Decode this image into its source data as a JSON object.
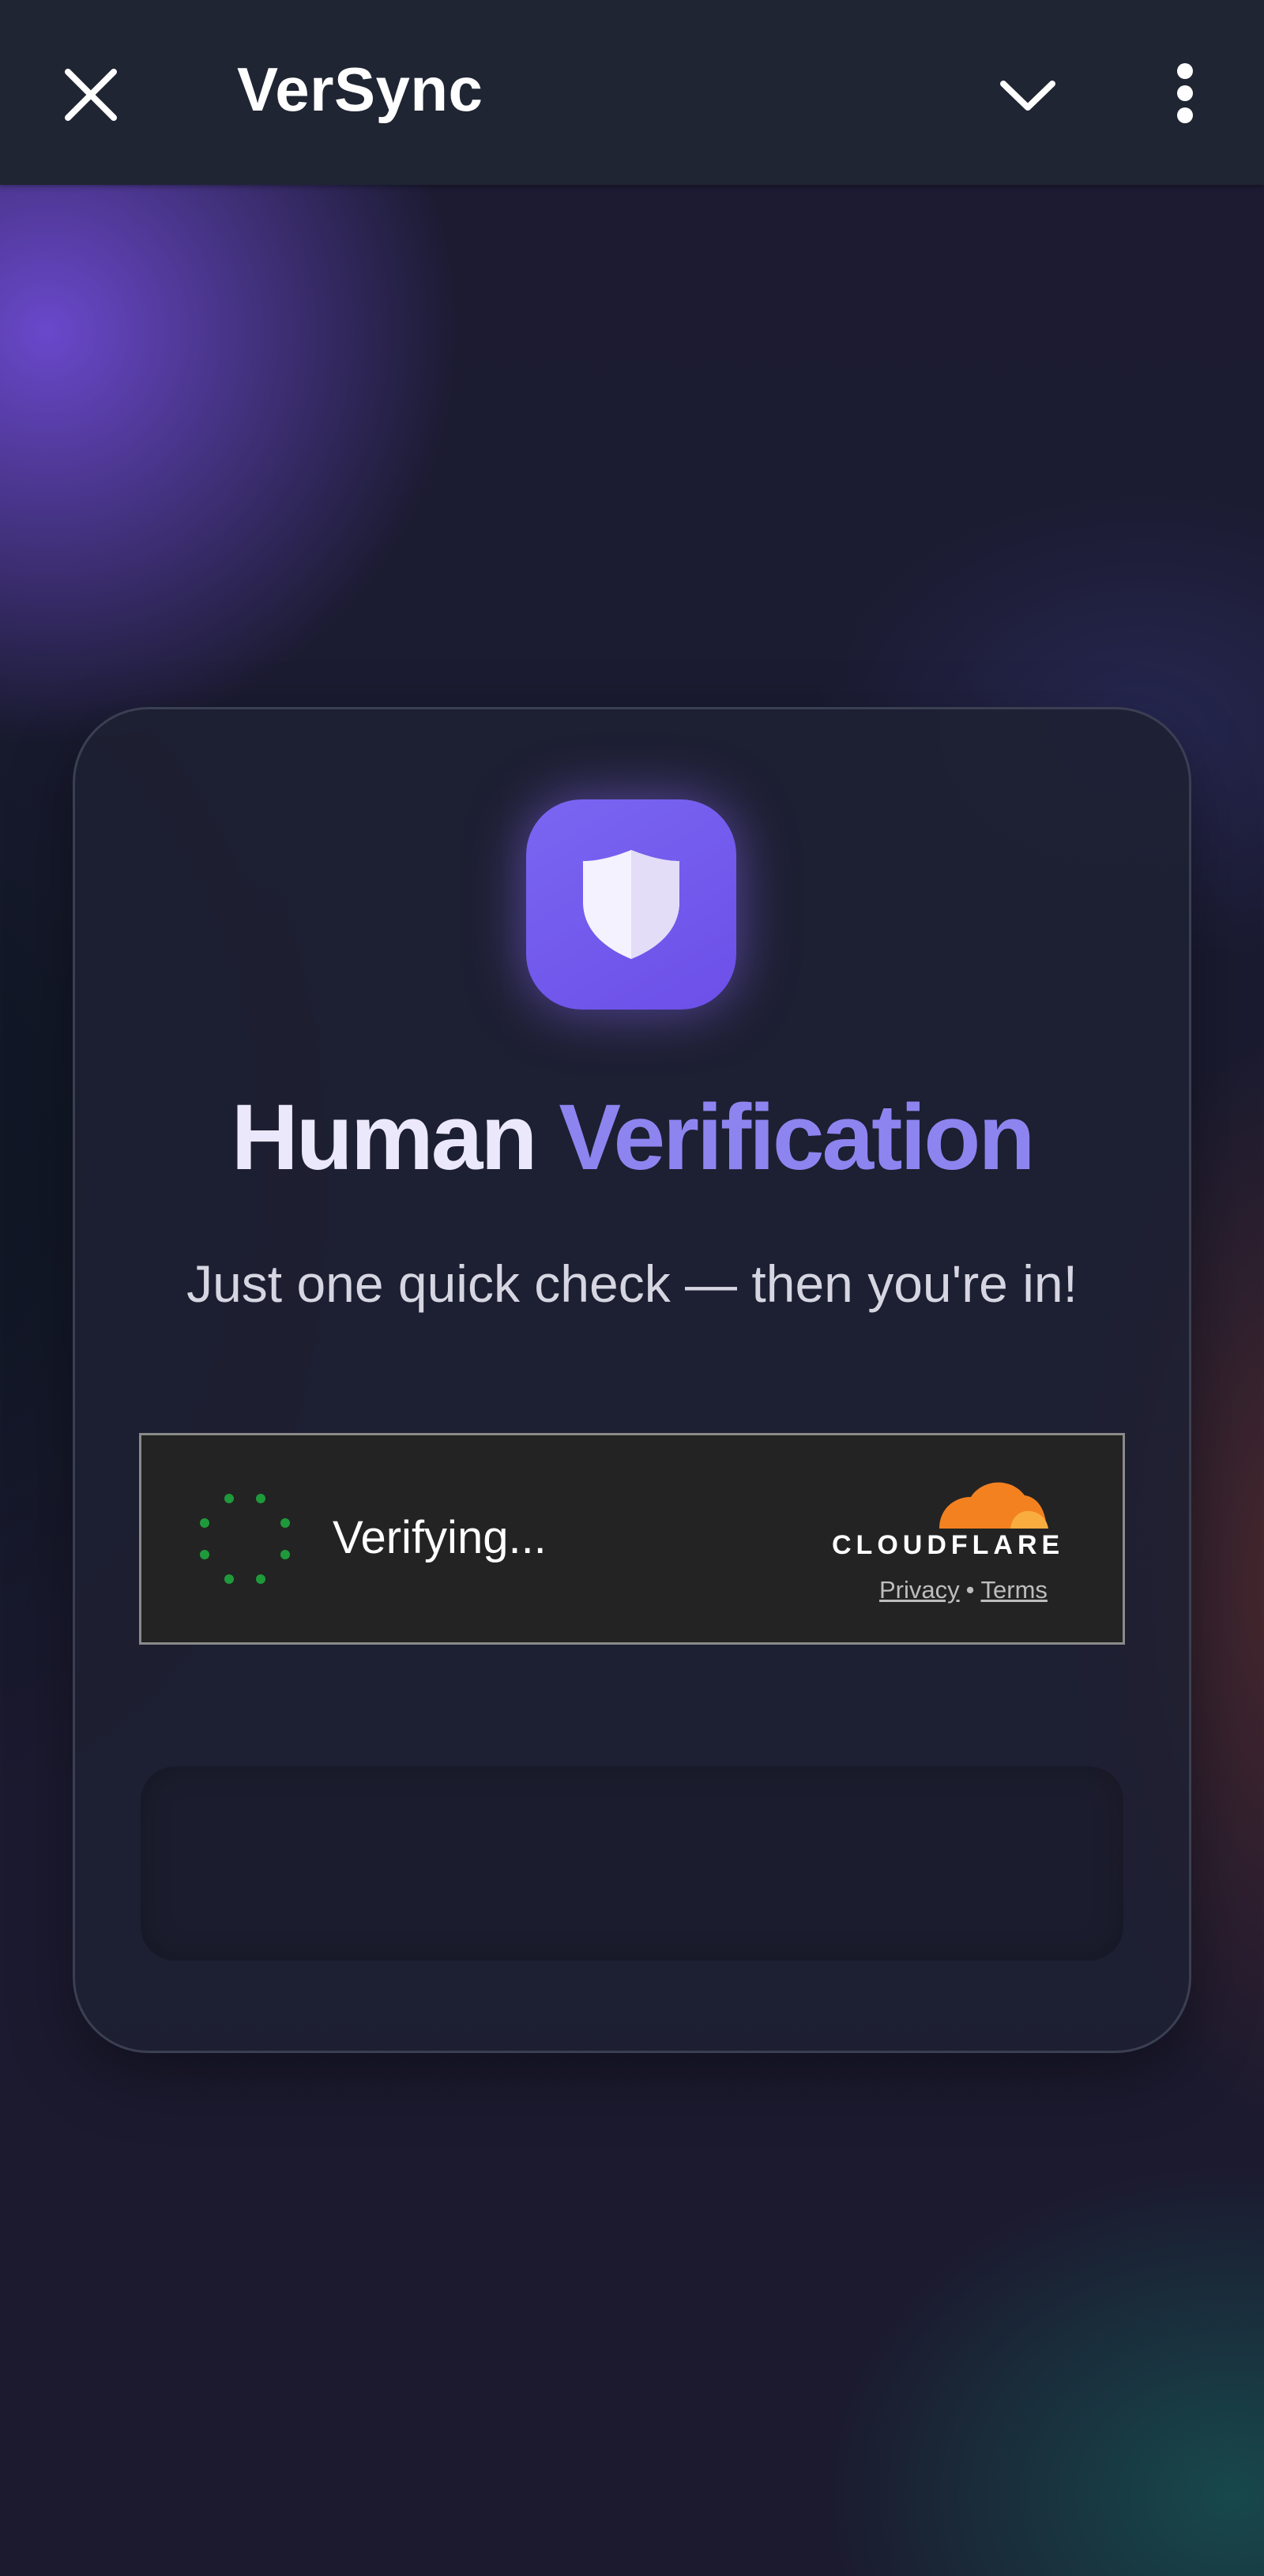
{
  "app_bar": {
    "title": "VerSync",
    "icons": [
      "close-icon",
      "chevron-down-icon",
      "more-vertical-icon"
    ]
  },
  "card": {
    "icon": "shield-icon",
    "heading_part1": "Human",
    "heading_part2": "Verification",
    "subtitle": "Just one quick check — then you're in!"
  },
  "turnstile": {
    "status": "Verifying...",
    "brand": "CLOUDFLARE",
    "privacy_link": "Privacy",
    "separator": "•",
    "terms_link": "Terms"
  },
  "colors": {
    "app_bar_bg": "#1f2532",
    "accent_purple": "#7a66f2",
    "heading_gradient_end": "#8e84f0",
    "spinner_green": "#1f9a3b",
    "cloudflare_orange": "#f48120"
  }
}
